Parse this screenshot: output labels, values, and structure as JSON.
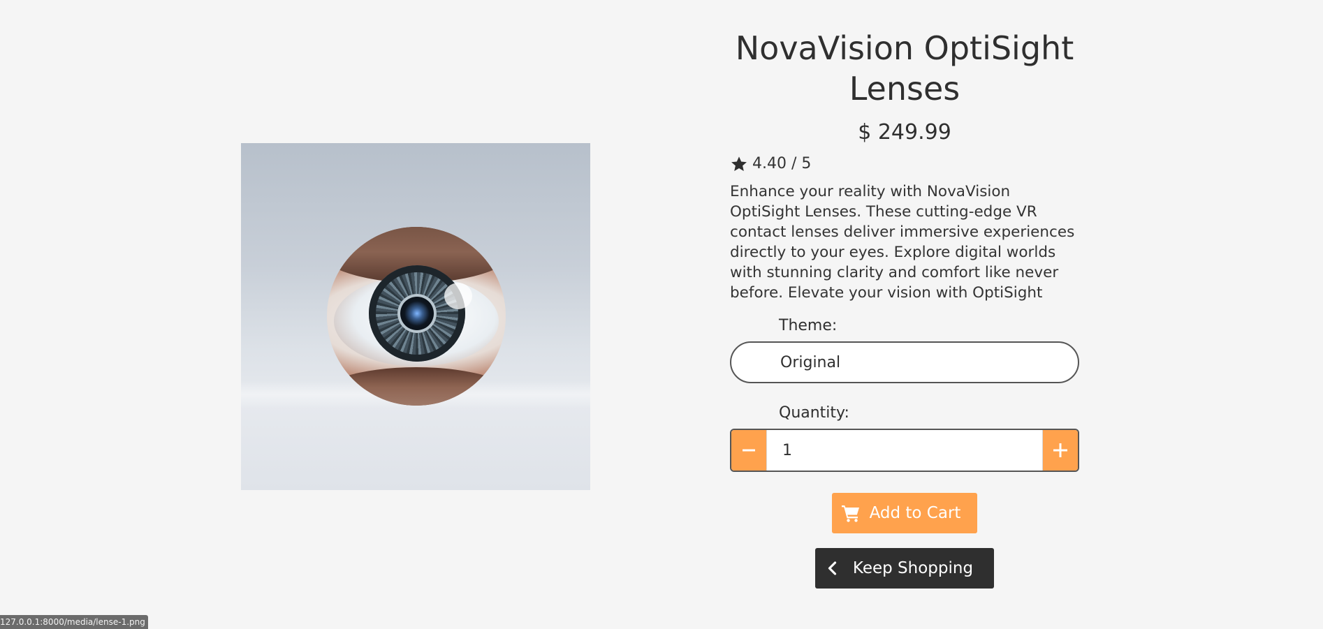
{
  "product": {
    "title": "NovaVision OptiSight Lenses",
    "price": "$ 249.99",
    "rating": "4.40 / 5",
    "description": "Enhance your reality with NovaVision OptiSight Lenses. These cutting-edge VR contact lenses deliver immersive experiences directly to your eyes. Explore digital worlds with stunning clarity and comfort like never before. Elevate your vision with OptiSight",
    "image_icon": "eye-lens-image"
  },
  "options": {
    "theme_label": "Theme:",
    "theme_value": "Original",
    "quantity_label": "Quantity:",
    "quantity_value": "1",
    "decrement_icon": "minus-icon",
    "increment_icon": "plus-icon"
  },
  "actions": {
    "add_to_cart": "Add to Cart",
    "keep_shopping": "Keep Shopping"
  },
  "status_bar": {
    "url": "127.0.0.1:8000/media/lense-1.png"
  },
  "colors": {
    "accent": "#ffa24d",
    "dark_button": "#2f2f2f",
    "background": "#f5f5f5"
  }
}
